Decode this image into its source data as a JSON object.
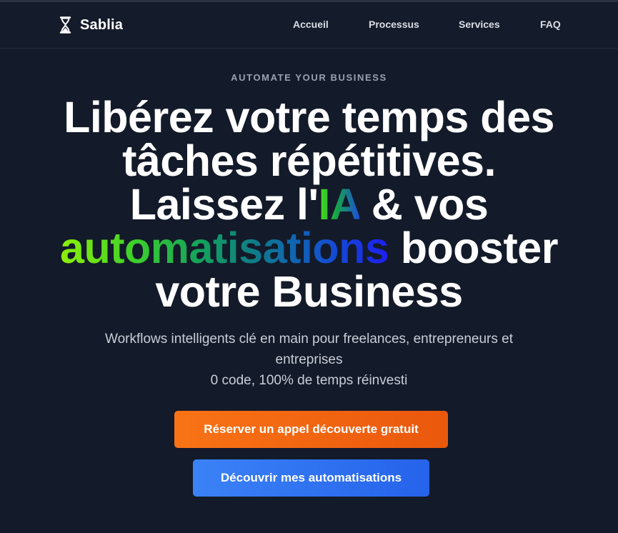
{
  "header": {
    "brand_name": "Sablia",
    "brand_icon": "hourglass-icon",
    "nav": [
      {
        "label": "Accueil"
      },
      {
        "label": "Processus"
      },
      {
        "label": "Services"
      },
      {
        "label": "FAQ"
      }
    ]
  },
  "hero": {
    "eyebrow": "AUTOMATE YOUR BUSINESS",
    "headline": {
      "line1": "Libérez votre temps des",
      "line2": "tâches répétitives.",
      "line3_a": "Laissez l'",
      "line3_highlight": "IA",
      "line3_b": " & vos",
      "line4_highlight": "automatisations",
      "line4_b": " booster",
      "line5": "votre Business"
    },
    "subtitle_line1": "Workflows intelligents clé en main pour freelances, entrepreneurs et entreprises",
    "subtitle_line2": "0 code, 100% de temps réinvesti",
    "cta_primary": "Réserver un appel découverte gratuit",
    "cta_secondary": "Découvrir mes automatisations"
  },
  "colors": {
    "background": "#131a29",
    "primary_cta": "#f97316",
    "secondary_cta": "#3b82f6",
    "gradient_start": "#8ef00b",
    "gradient_end": "#1d1ff0"
  }
}
